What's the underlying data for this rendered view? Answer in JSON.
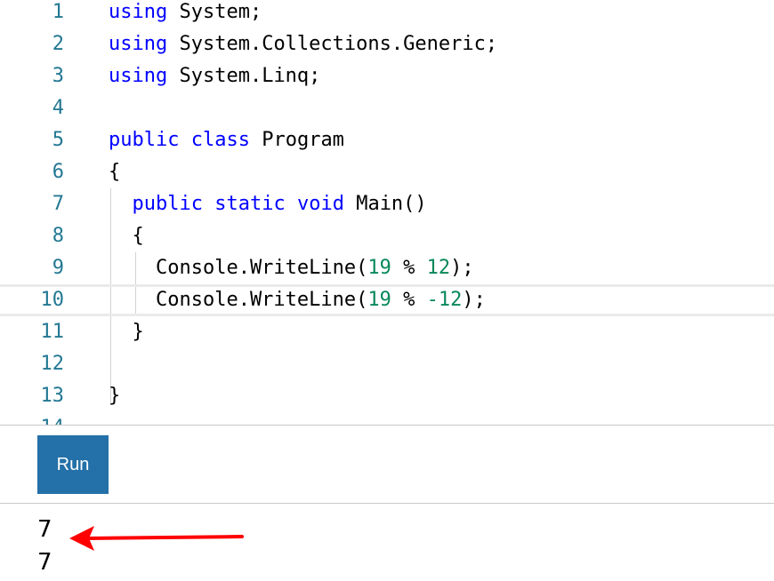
{
  "editor": {
    "lines": [
      {
        "num": "1",
        "tokens": [
          {
            "t": "using",
            "c": "kw"
          },
          {
            "t": " System;"
          }
        ]
      },
      {
        "num": "2",
        "tokens": [
          {
            "t": "using",
            "c": "kw"
          },
          {
            "t": " System.Collections.Generic;"
          }
        ]
      },
      {
        "num": "3",
        "tokens": [
          {
            "t": "using",
            "c": "kw"
          },
          {
            "t": " System.Linq;"
          }
        ]
      },
      {
        "num": "4",
        "tokens": []
      },
      {
        "num": "5",
        "tokens": [
          {
            "t": "public",
            "c": "kw"
          },
          {
            "t": " "
          },
          {
            "t": "class",
            "c": "kw"
          },
          {
            "t": " Program"
          }
        ]
      },
      {
        "num": "6",
        "tokens": [
          {
            "t": "{"
          }
        ]
      },
      {
        "num": "7",
        "tokens": [
          {
            "t": "  "
          },
          {
            "t": "public",
            "c": "kw"
          },
          {
            "t": " "
          },
          {
            "t": "static",
            "c": "kw"
          },
          {
            "t": " "
          },
          {
            "t": "void",
            "c": "kw"
          },
          {
            "t": " Main()"
          }
        ]
      },
      {
        "num": "8",
        "tokens": [
          {
            "t": "  {"
          }
        ]
      },
      {
        "num": "9",
        "tokens": [
          {
            "t": "    Console.WriteLine("
          },
          {
            "t": "19",
            "c": "num"
          },
          {
            "t": " % "
          },
          {
            "t": "12",
            "c": "num"
          },
          {
            "t": ");"
          }
        ]
      },
      {
        "num": "10",
        "tokens": [
          {
            "t": "    Console.WriteLine("
          },
          {
            "t": "19",
            "c": "num"
          },
          {
            "t": " % "
          },
          {
            "t": "-12",
            "c": "num"
          },
          {
            "t": ");"
          }
        ],
        "current": true
      },
      {
        "num": "11",
        "tokens": [
          {
            "t": "  }"
          }
        ]
      },
      {
        "num": "12",
        "tokens": []
      },
      {
        "num": "13",
        "tokens": [
          {
            "t": "}"
          }
        ]
      },
      {
        "num": "14",
        "tokens": []
      }
    ]
  },
  "run_button": {
    "label": "Run",
    "color": "#2470a8"
  },
  "output": {
    "lines": [
      "7",
      "7"
    ]
  },
  "annotation": {
    "icon": "red-arrow-icon",
    "color": "#ff0000"
  }
}
